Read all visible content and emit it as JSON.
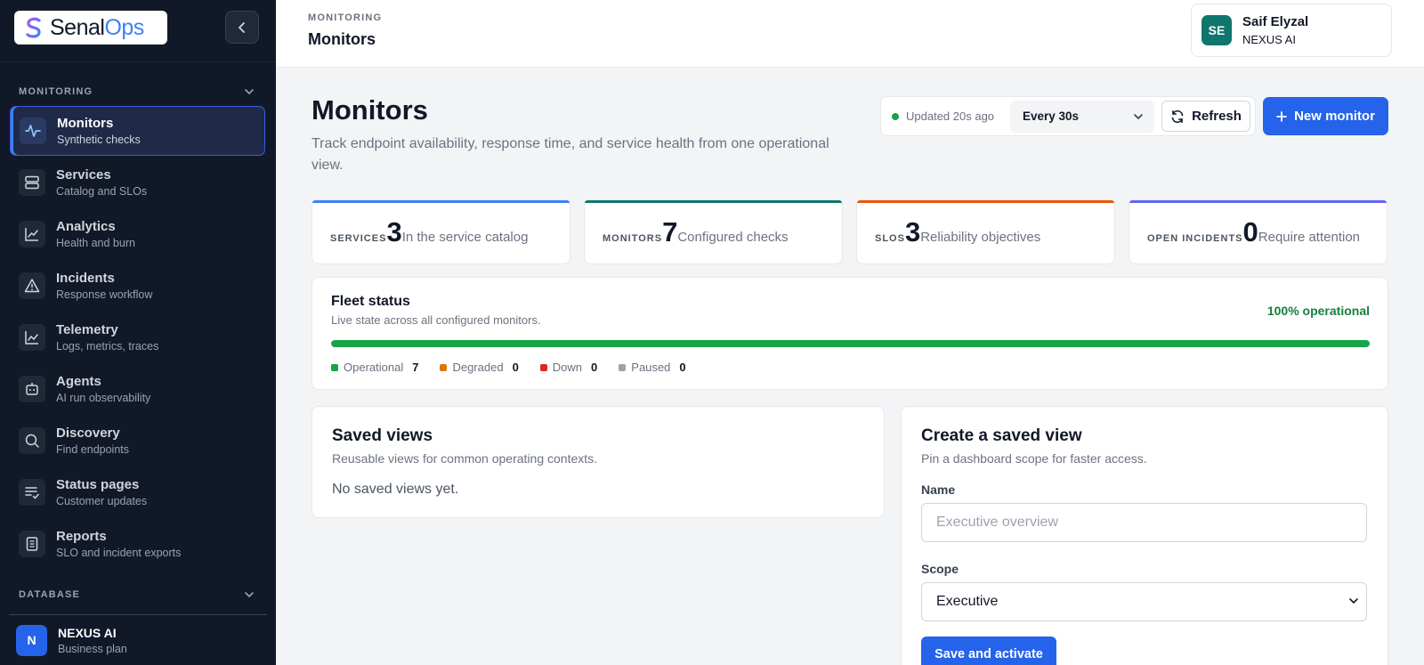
{
  "brand": {
    "name_part1": "Senal",
    "name_part2": "Ops"
  },
  "sidebar": {
    "monitoring_section": "MONITORING",
    "items": [
      {
        "title": "Monitors",
        "subtitle": "Synthetic checks",
        "icon": "activity-icon"
      },
      {
        "title": "Services",
        "subtitle": "Catalog and SLOs",
        "icon": "server-icon"
      },
      {
        "title": "Analytics",
        "subtitle": "Health and burn",
        "icon": "line-chart-icon"
      },
      {
        "title": "Incidents",
        "subtitle": "Response workflow",
        "icon": "alert-triangle-icon"
      },
      {
        "title": "Telemetry",
        "subtitle": "Logs, metrics, traces",
        "icon": "chart-icon"
      },
      {
        "title": "Agents",
        "subtitle": "AI run observability",
        "icon": "bot-icon"
      },
      {
        "title": "Discovery",
        "subtitle": "Find endpoints",
        "icon": "search-icon"
      },
      {
        "title": "Status pages",
        "subtitle": "Customer updates",
        "icon": "list-check-icon"
      },
      {
        "title": "Reports",
        "subtitle": "SLO and incident exports",
        "icon": "document-icon"
      }
    ],
    "database_section": "DATABASE",
    "org": {
      "initial": "N",
      "name": "NEXUS AI",
      "plan": "Business plan"
    }
  },
  "topbar": {
    "breadcrumb": "MONITORING",
    "title": "Monitors",
    "user": {
      "initials": "SE",
      "name": "Saif Elyzal",
      "org": "NEXUS AI"
    }
  },
  "page": {
    "title": "Monitors",
    "description": "Track endpoint availability, response time, and service health from one operational view."
  },
  "controls": {
    "updated": "Updated 20s ago",
    "interval": "Every 30s",
    "refresh_label": "Refresh",
    "new_monitor_label": "New monitor"
  },
  "stats": [
    {
      "label": "SERVICES",
      "value": "3",
      "desc": "In the service catalog",
      "accent": "#3b82f6"
    },
    {
      "label": "MONITORS",
      "value": "7",
      "desc": "Configured checks",
      "accent": "#0f766e"
    },
    {
      "label": "SLOS",
      "value": "3",
      "desc": "Reliability objectives",
      "accent": "#ea580c"
    },
    {
      "label": "OPEN INCIDENTS",
      "value": "0",
      "desc": "Require attention",
      "accent": "#6366f1"
    }
  ],
  "fleet": {
    "title": "Fleet status",
    "subtitle": "Live state across all configured monitors.",
    "percent_label": "100% operational",
    "operational_fraction": 1.0,
    "legend": [
      {
        "label": "Operational",
        "count": "7",
        "color": "#16a34a"
      },
      {
        "label": "Degraded",
        "count": "0",
        "color": "#d97706"
      },
      {
        "label": "Down",
        "count": "0",
        "color": "#dc2626"
      },
      {
        "label": "Paused",
        "count": "0",
        "color": "#9ca3af"
      }
    ]
  },
  "saved_views": {
    "title": "Saved views",
    "subtitle": "Reusable views for common operating contexts.",
    "empty": "No saved views yet."
  },
  "create_view": {
    "title": "Create a saved view",
    "subtitle": "Pin a dashboard scope for faster access.",
    "name_label": "Name",
    "name_placeholder": "Executive overview",
    "scope_label": "Scope",
    "scope_value": "Executive",
    "save_label": "Save and activate"
  }
}
